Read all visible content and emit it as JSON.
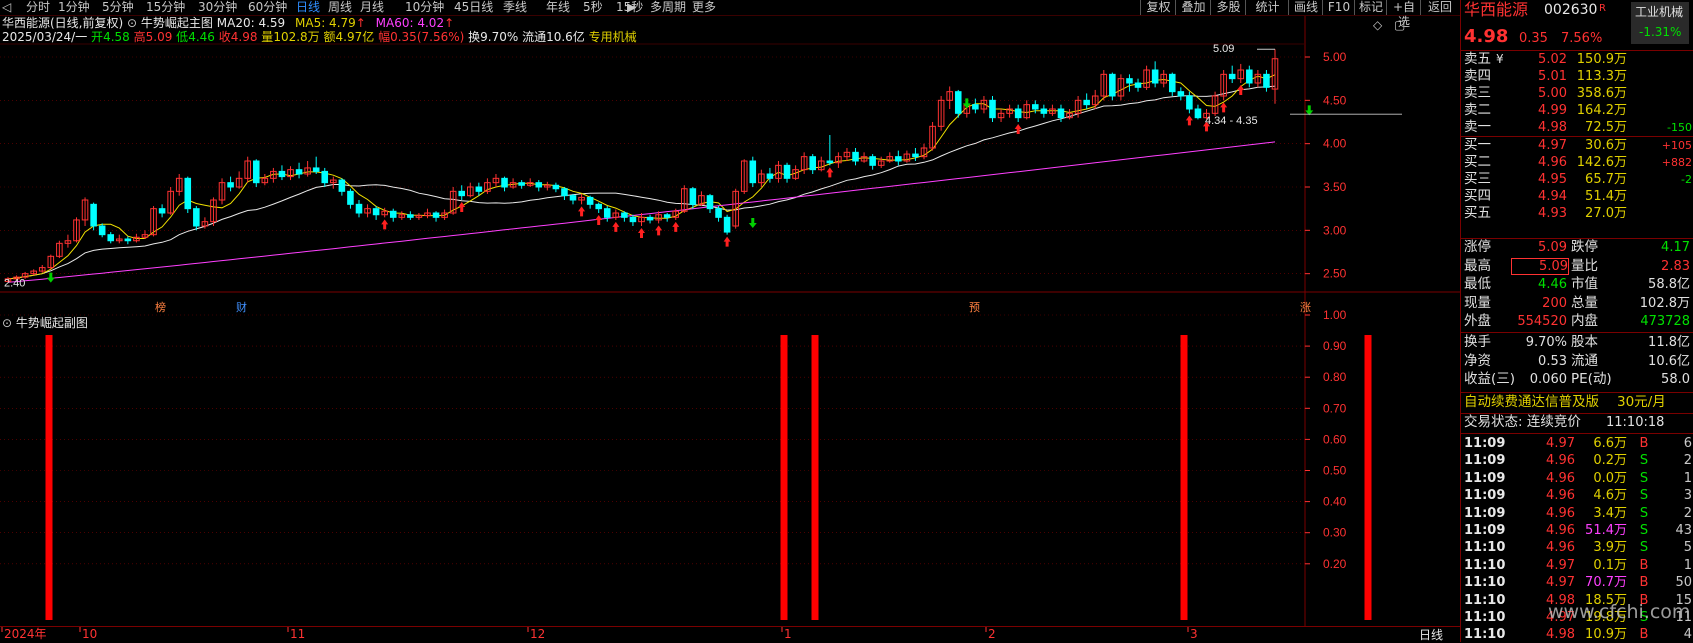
{
  "topbar": {
    "periods": [
      "分时",
      "1分钟",
      "5分钟",
      "15分钟",
      "30分钟",
      "60分钟",
      "日线",
      "周线",
      "月线",
      "10分钟",
      "45日线",
      "季线",
      "年线",
      "5秒",
      "15秒",
      "多周期",
      "更多"
    ],
    "active_period": "日线",
    "more_arrow": "▶",
    "right_buttons": [
      "复权",
      "叠加",
      "多股",
      "统计",
      "画线",
      "F10",
      "标记",
      "+自选",
      "返回"
    ]
  },
  "main_chart": {
    "title_stock": "华西能源(日线,前复权)",
    "indicator_name": "牛势崛起主图",
    "ma20_label": "MA20: 4.59",
    "ma5_label": "MA5: 4.79",
    "ma60_label": "MA60: 4.02",
    "arrow_up": "↑",
    "info_date": "2025/03/24/一",
    "info_open_label": "开",
    "info_open": "4.58",
    "info_high_label": "高",
    "info_high": "5.09",
    "info_low_label": "低",
    "info_low": "4.46",
    "info_close_label": "收",
    "info_close": "4.98",
    "info_vol_label": "量",
    "info_vol": "102.8万",
    "info_amt_label": "额",
    "info_amt": "4.97亿",
    "info_chg_label": "幅",
    "info_chg": "0.35(7.56%)",
    "info_turn": "换9.70%",
    "info_float": "流通10.6亿",
    "info_sector": "专用机械",
    "y_ticks": [
      "5.00",
      "4.50",
      "4.00",
      "3.50",
      "3.00",
      "2.50"
    ],
    "max_label": "5.09",
    "min_label": "2.40",
    "range_label": "4.34 - 4.35",
    "event_labels": [
      "榜",
      "财",
      "预",
      "涨"
    ],
    "window_icons": [
      "◇",
      "▢"
    ]
  },
  "sub_chart": {
    "title": "牛势崛起副图",
    "y_ticks": [
      "1.00",
      "0.90",
      "0.80",
      "0.70",
      "0.60",
      "0.50",
      "0.40",
      "0.30",
      "0.20"
    ]
  },
  "x_axis": {
    "labels": [
      "2024年",
      "10",
      "11",
      "12",
      "1",
      "2",
      "3"
    ],
    "period_label": "日线"
  },
  "chart_data": {
    "type": "candlestick",
    "ylim": [
      2.3,
      5.15
    ],
    "candles": [
      [
        2.41,
        2.44,
        2.46,
        2.4
      ],
      [
        2.44,
        2.46,
        2.48,
        2.42
      ],
      [
        2.46,
        2.5,
        2.52,
        2.44
      ],
      [
        2.5,
        2.53,
        2.55,
        2.48
      ],
      [
        2.53,
        2.57,
        2.6,
        2.51
      ],
      [
        2.57,
        2.7,
        2.72,
        2.55
      ],
      [
        2.7,
        2.85,
        2.88,
        2.68
      ],
      [
        2.85,
        2.88,
        2.95,
        2.8
      ],
      [
        2.88,
        3.12,
        3.15,
        2.86
      ],
      [
        3.12,
        3.35,
        3.38,
        3.05
      ],
      [
        3.3,
        3.05,
        3.32,
        3.0
      ],
      [
        3.05,
        2.95,
        3.08,
        2.92
      ],
      [
        2.95,
        2.88,
        2.98,
        2.85
      ],
      [
        2.88,
        2.9,
        2.95,
        2.85
      ],
      [
        2.9,
        2.88,
        2.93,
        2.84
      ],
      [
        2.88,
        2.92,
        2.96,
        2.86
      ],
      [
        2.92,
        2.95,
        3.0,
        2.9
      ],
      [
        2.95,
        3.25,
        3.28,
        2.93
      ],
      [
        3.25,
        3.2,
        3.3,
        3.15
      ],
      [
        3.2,
        3.45,
        3.5,
        3.18
      ],
      [
        3.45,
        3.6,
        3.65,
        3.4
      ],
      [
        3.6,
        3.25,
        3.62,
        3.2
      ],
      [
        3.25,
        3.05,
        3.28,
        3.0
      ],
      [
        3.05,
        3.1,
        3.15,
        3.02
      ],
      [
        3.1,
        3.35,
        3.38,
        3.05
      ],
      [
        3.35,
        3.55,
        3.6,
        3.3
      ],
      [
        3.55,
        3.5,
        3.62,
        3.45
      ],
      [
        3.5,
        3.6,
        3.68,
        3.48
      ],
      [
        3.6,
        3.8,
        3.85,
        3.55
      ],
      [
        3.8,
        3.55,
        3.82,
        3.5
      ],
      [
        3.55,
        3.6,
        3.65,
        3.52
      ],
      [
        3.6,
        3.68,
        3.72,
        3.55
      ],
      [
        3.68,
        3.62,
        3.75,
        3.58
      ],
      [
        3.62,
        3.7,
        3.74,
        3.58
      ],
      [
        3.7,
        3.65,
        3.78,
        3.6
      ],
      [
        3.65,
        3.72,
        3.8,
        3.62
      ],
      [
        3.72,
        3.68,
        3.85,
        3.65
      ],
      [
        3.68,
        3.55,
        3.72,
        3.5
      ],
      [
        3.55,
        3.58,
        3.62,
        3.48
      ],
      [
        3.58,
        3.45,
        3.6,
        3.4
      ],
      [
        3.45,
        3.3,
        3.48,
        3.25
      ],
      [
        3.3,
        3.2,
        3.35,
        3.15
      ],
      [
        3.2,
        3.25,
        3.3,
        3.15
      ],
      [
        3.25,
        3.18,
        3.28,
        3.12
      ],
      [
        3.18,
        3.22,
        3.26,
        3.15
      ],
      [
        3.22,
        3.15,
        3.25,
        3.1
      ],
      [
        3.15,
        3.18,
        3.22,
        3.12
      ],
      [
        3.18,
        3.15,
        3.22,
        3.12
      ],
      [
        3.15,
        3.17,
        3.2,
        3.12
      ],
      [
        3.17,
        3.2,
        3.25,
        3.14
      ],
      [
        3.2,
        3.15,
        3.22,
        3.1
      ],
      [
        3.15,
        3.2,
        3.24,
        3.12
      ],
      [
        3.2,
        3.45,
        3.5,
        3.18
      ],
      [
        3.45,
        3.4,
        3.52,
        3.35
      ],
      [
        3.4,
        3.5,
        3.55,
        3.38
      ],
      [
        3.5,
        3.45,
        3.55,
        3.4
      ],
      [
        3.45,
        3.55,
        3.6,
        3.42
      ],
      [
        3.55,
        3.6,
        3.65,
        3.5
      ],
      [
        3.6,
        3.5,
        3.62,
        3.45
      ],
      [
        3.5,
        3.55,
        3.6,
        3.48
      ],
      [
        3.55,
        3.52,
        3.58,
        3.48
      ],
      [
        3.52,
        3.55,
        3.6,
        3.5
      ],
      [
        3.55,
        3.5,
        3.58,
        3.45
      ],
      [
        3.5,
        3.52,
        3.56,
        3.46
      ],
      [
        3.52,
        3.48,
        3.55,
        3.44
      ],
      [
        3.48,
        3.4,
        3.5,
        3.35
      ],
      [
        3.4,
        3.35,
        3.42,
        3.3
      ],
      [
        3.35,
        3.38,
        3.42,
        3.3
      ],
      [
        3.38,
        3.3,
        3.4,
        3.25
      ],
      [
        3.3,
        3.25,
        3.32,
        3.2
      ],
      [
        3.25,
        3.15,
        3.28,
        3.1
      ],
      [
        3.15,
        3.2,
        3.24,
        3.12
      ],
      [
        3.2,
        3.15,
        3.22,
        3.1
      ],
      [
        3.15,
        3.1,
        3.18,
        3.05
      ],
      [
        3.1,
        3.15,
        3.2,
        3.05
      ],
      [
        3.15,
        3.12,
        3.18,
        3.08
      ],
      [
        3.12,
        3.18,
        3.22,
        3.08
      ],
      [
        3.18,
        3.15,
        3.2,
        3.1
      ],
      [
        3.15,
        3.22,
        3.25,
        3.12
      ],
      [
        3.22,
        3.48,
        3.52,
        3.2
      ],
      [
        3.48,
        3.3,
        3.5,
        3.25
      ],
      [
        3.3,
        3.4,
        3.45,
        3.28
      ],
      [
        3.4,
        3.25,
        3.42,
        3.2
      ],
      [
        3.25,
        3.15,
        3.28,
        3.1
      ],
      [
        3.15,
        2.98,
        3.18,
        2.95
      ],
      [
        3.05,
        3.45,
        3.48,
        3.02
      ],
      [
        3.45,
        3.8,
        3.82,
        3.42
      ],
      [
        3.8,
        3.55,
        3.85,
        3.5
      ],
      [
        3.55,
        3.65,
        3.7,
        3.5
      ],
      [
        3.65,
        3.6,
        3.72,
        3.55
      ],
      [
        3.6,
        3.75,
        3.8,
        3.55
      ],
      [
        3.75,
        3.6,
        3.78,
        3.55
      ],
      [
        3.6,
        3.7,
        3.75,
        3.58
      ],
      [
        3.7,
        3.85,
        3.9,
        3.65
      ],
      [
        3.85,
        3.7,
        3.88,
        3.65
      ],
      [
        3.7,
        3.8,
        3.85,
        3.68
      ],
      [
        3.8,
        3.78,
        4.1,
        3.75
      ],
      [
        3.78,
        3.85,
        3.9,
        3.72
      ],
      [
        3.85,
        3.9,
        3.95,
        3.8
      ],
      [
        3.9,
        3.8,
        3.95,
        3.75
      ],
      [
        3.8,
        3.85,
        3.9,
        3.78
      ],
      [
        3.85,
        3.75,
        3.88,
        3.7
      ],
      [
        3.75,
        3.8,
        3.85,
        3.72
      ],
      [
        3.8,
        3.85,
        3.9,
        3.78
      ],
      [
        3.85,
        3.8,
        3.92,
        3.75
      ],
      [
        3.8,
        3.88,
        3.92,
        3.78
      ],
      [
        3.88,
        3.85,
        3.95,
        3.8
      ],
      [
        3.85,
        3.95,
        4.0,
        3.82
      ],
      [
        3.95,
        4.2,
        4.25,
        3.92
      ],
      [
        4.2,
        4.5,
        4.55,
        4.15
      ],
      [
        4.5,
        4.6,
        4.66,
        4.4
      ],
      [
        4.6,
        4.35,
        4.62,
        4.3
      ],
      [
        4.35,
        4.45,
        4.5,
        4.3
      ],
      [
        4.45,
        4.4,
        4.52,
        4.35
      ],
      [
        4.4,
        4.5,
        4.55,
        4.35
      ],
      [
        4.5,
        4.3,
        4.55,
        4.25
      ],
      [
        4.3,
        4.35,
        4.4,
        4.25
      ],
      [
        4.35,
        4.4,
        4.45,
        4.3
      ],
      [
        4.4,
        4.3,
        4.45,
        4.25
      ],
      [
        4.3,
        4.45,
        4.5,
        4.28
      ],
      [
        4.45,
        4.4,
        4.5,
        4.35
      ],
      [
        4.4,
        4.35,
        4.45,
        4.3
      ],
      [
        4.35,
        4.4,
        4.45,
        4.32
      ],
      [
        4.4,
        4.3,
        4.45,
        4.25
      ],
      [
        4.3,
        4.35,
        4.4,
        4.28
      ],
      [
        4.35,
        4.5,
        4.55,
        4.3
      ],
      [
        4.5,
        4.45,
        4.58,
        4.4
      ],
      [
        4.45,
        4.55,
        4.62,
        4.4
      ],
      [
        4.55,
        4.8,
        4.85,
        4.5
      ],
      [
        4.8,
        4.55,
        4.82,
        4.5
      ],
      [
        4.55,
        4.75,
        4.8,
        4.5
      ],
      [
        4.75,
        4.7,
        4.8,
        4.6
      ],
      [
        4.7,
        4.65,
        4.75,
        4.6
      ],
      [
        4.65,
        4.85,
        4.9,
        4.62
      ],
      [
        4.85,
        4.7,
        4.95,
        4.65
      ],
      [
        4.7,
        4.8,
        4.85,
        4.65
      ],
      [
        4.8,
        4.6,
        4.82,
        4.55
      ],
      [
        4.6,
        4.55,
        4.65,
        4.5
      ],
      [
        4.55,
        4.4,
        4.6,
        4.35
      ],
      [
        4.4,
        4.3,
        4.45,
        4.28
      ],
      [
        4.3,
        4.35,
        4.4,
        4.28
      ],
      [
        4.35,
        4.55,
        4.6,
        4.32
      ],
      [
        4.55,
        4.8,
        4.85,
        4.5
      ],
      [
        4.8,
        4.75,
        4.9,
        4.7
      ],
      [
        4.75,
        4.85,
        4.92,
        4.7
      ],
      [
        4.85,
        4.7,
        4.9,
        4.65
      ],
      [
        4.7,
        4.8,
        4.85,
        4.65
      ],
      [
        4.8,
        4.65,
        4.85,
        4.6
      ],
      [
        4.63,
        4.98,
        5.09,
        4.46
      ]
    ],
    "ma60": {
      "start": 2.4,
      "end": 4.02
    },
    "sub_signals_index": [
      4,
      87,
      91,
      131,
      152
    ]
  },
  "right_panel": {
    "stock_name": "华西能源",
    "stock_code": "002630",
    "r_tag": "R",
    "industry": "工业机械",
    "industry_chg": "-1.31%",
    "price": "4.98",
    "change": "0.35",
    "change_pct": "7.56%",
    "sells": [
      {
        "label": "卖五",
        "extra": "¥",
        "price": "5.02",
        "vol": "150.9万",
        "delta": ""
      },
      {
        "label": "卖四",
        "extra": "",
        "price": "5.01",
        "vol": "113.3万",
        "delta": ""
      },
      {
        "label": "卖三",
        "extra": "",
        "price": "5.00",
        "vol": "358.6万",
        "delta": ""
      },
      {
        "label": "卖二",
        "extra": "",
        "price": "4.99",
        "vol": "164.2万",
        "delta": ""
      },
      {
        "label": "卖一",
        "extra": "",
        "price": "4.98",
        "vol": "72.5万",
        "delta": "-150"
      }
    ],
    "buys": [
      {
        "label": "买一",
        "price": "4.97",
        "vol": "30.6万",
        "delta": "+105"
      },
      {
        "label": "买二",
        "price": "4.96",
        "vol": "142.6万",
        "delta": "+882"
      },
      {
        "label": "买三",
        "price": "4.95",
        "vol": "65.7万",
        "delta": "-2"
      },
      {
        "label": "买四",
        "price": "4.94",
        "vol": "51.4万",
        "delta": ""
      },
      {
        "label": "买五",
        "price": "4.93",
        "vol": "27.0万",
        "delta": ""
      }
    ],
    "stats": [
      {
        "l1": "涨停",
        "v1": "5.09",
        "c1": "red",
        "l2": "跌停",
        "v2": "4.17",
        "c2": "grn"
      },
      {
        "l1": "最高",
        "v1": "5.09",
        "c1": "red",
        "l2": "量比",
        "v2": "2.83",
        "c2": "red"
      },
      {
        "l1": "最低",
        "v1": "4.46",
        "c1": "grn",
        "l2": "市值",
        "v2": "58.8亿",
        "c2": "wht"
      },
      {
        "l1": "现量",
        "v1": "200",
        "c1": "red",
        "l2": "总量",
        "v2": "102.8万",
        "c2": "wht"
      },
      {
        "l1": "外盘",
        "v1": "554520",
        "c1": "red",
        "l2": "内盘",
        "v2": "473728",
        "c2": "grn"
      }
    ],
    "stats2": [
      {
        "l1": "换手",
        "v1": "9.70%",
        "l2": "股本",
        "v2": "11.8亿"
      },
      {
        "l1": "净资",
        "v1": "0.53",
        "l2": "流通",
        "v2": "10.6亿"
      },
      {
        "l1": "收益(三)",
        "v1": "0.060",
        "l2": "PE(动)",
        "v2": "58.0"
      }
    ],
    "promo": "自动续费通达信普及版",
    "promo_price": "30元/月",
    "trade_status_label": "交易状态: 连续竞价",
    "trade_time": "11:10:18",
    "ticks": [
      {
        "t": "11:09",
        "p": "4.97",
        "v": "6.6万",
        "bs": "B",
        "n": "6"
      },
      {
        "t": "11:09",
        "p": "4.96",
        "v": "0.2万",
        "bs": "S",
        "n": "2"
      },
      {
        "t": "11:09",
        "p": "4.96",
        "v": "0.0万",
        "bs": "S",
        "n": "1"
      },
      {
        "t": "11:09",
        "p": "4.96",
        "v": "4.6万",
        "bs": "S",
        "n": "3"
      },
      {
        "t": "11:09",
        "p": "4.96",
        "v": "3.4万",
        "bs": "S",
        "n": "2"
      },
      {
        "t": "11:09",
        "p": "4.96",
        "v": "51.4万",
        "bs": "S",
        "n": "43"
      },
      {
        "t": "11:10",
        "p": "4.96",
        "v": "3.9万",
        "bs": "S",
        "n": "5"
      },
      {
        "t": "11:10",
        "p": "4.97",
        "v": "0.1万",
        "bs": "B",
        "n": "1"
      },
      {
        "t": "11:10",
        "p": "4.97",
        "v": "70.7万",
        "bs": "B",
        "n": "50"
      },
      {
        "t": "11:10",
        "p": "4.98",
        "v": "18.5万",
        "bs": "B",
        "n": "15"
      },
      {
        "t": "11:10",
        "p": "4.97",
        "v": "19.8万",
        "bs": "S",
        "n": "11"
      },
      {
        "t": "11:10",
        "p": "4.98",
        "v": "10.9万",
        "bs": "B",
        "n": "4"
      }
    ]
  },
  "watermark": "www.cfchi.com",
  "colors": {
    "up": "#ff3232",
    "down": "#00ffff",
    "ma5": "#f0e000",
    "ma20": "#e8e8e8",
    "ma60": "#ff40ff",
    "signal": "#ff0000",
    "grid": "#7a0000"
  }
}
